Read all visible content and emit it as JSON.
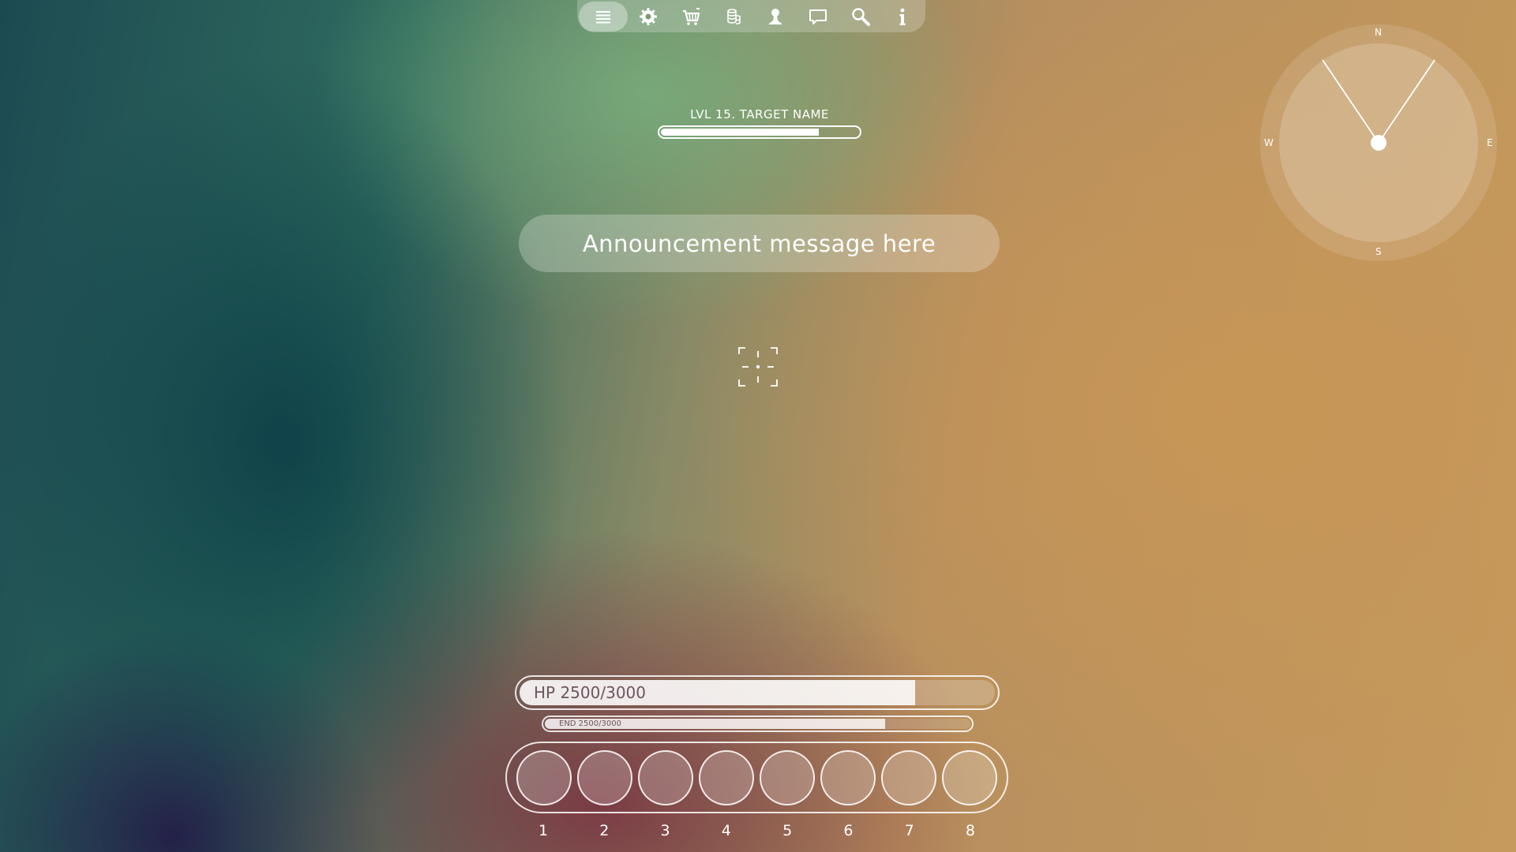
{
  "menu": {
    "items": [
      {
        "icon": "menu-icon",
        "active": true
      },
      {
        "icon": "gear-icon",
        "active": false
      },
      {
        "icon": "cart-icon",
        "active": false
      },
      {
        "icon": "coins-icon",
        "active": false
      },
      {
        "icon": "user-icon",
        "active": false
      },
      {
        "icon": "chat-icon",
        "active": false
      },
      {
        "icon": "search-icon",
        "active": false
      },
      {
        "icon": "info-icon",
        "active": false
      }
    ]
  },
  "target": {
    "name": "LVL 15. TARGET NAME",
    "health_fraction": 0.8
  },
  "announcement": {
    "text": "Announcement message here"
  },
  "compass": {
    "north": "N",
    "south": "S",
    "east": "E",
    "west": "W"
  },
  "player": {
    "hp_label": "HP 2500/3000",
    "hp_fraction": 0.833,
    "end_label": "END 2500/3000",
    "end_fraction": 0.8
  },
  "hotbar": {
    "slots": [
      "1",
      "2",
      "3",
      "4",
      "5",
      "6",
      "7",
      "8"
    ]
  },
  "colors": {
    "hud_white": "#ffffff",
    "bar_text": "#6d5560"
  }
}
